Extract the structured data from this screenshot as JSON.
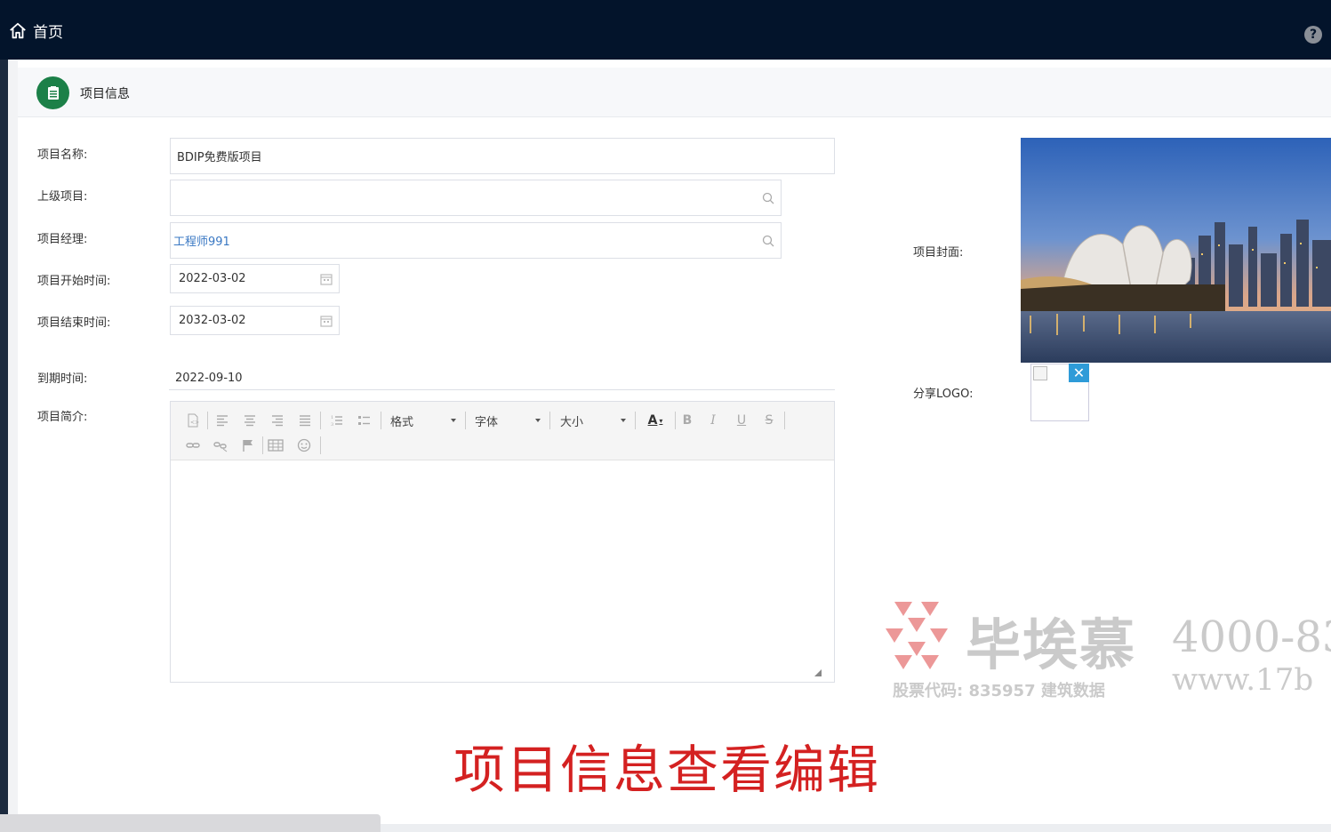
{
  "topbar": {
    "home_label": "首页",
    "help_glyph": "?"
  },
  "panel": {
    "title": "项目信息"
  },
  "form": {
    "name_label": "项目名称:",
    "name_value": "BDIP免费版项目",
    "parent_label": "上级项目:",
    "parent_value": "",
    "manager_label": "项目经理:",
    "manager_value": "工程师991",
    "start_label": "项目开始时间:",
    "start_value": "2022-03-02",
    "end_label": "项目结束时间:",
    "end_value": "2032-03-02",
    "expire_label": "到期时间:",
    "expire_value": "2022-09-10",
    "intro_label": "项目简介:",
    "cover_label": "项目封面:",
    "logo_label": "分享LOGO:"
  },
  "editor": {
    "format_label": "格式",
    "font_label": "字体",
    "size_label": "大小",
    "bold": "B",
    "italic": "I",
    "underline": "U",
    "strike": "S",
    "color_letter": "A"
  },
  "watermark": {
    "brand": "毕埃慕",
    "phone": "4000-83",
    "stock_code": "股票代码: 835957 建筑数据",
    "url": "www.17b"
  },
  "caption": "项目信息查看编辑",
  "colors": {
    "topbar": "#03142b",
    "accent_green": "#1c8048",
    "link": "#3a78c3",
    "caption_red": "#d42121",
    "close_blue": "#2e9bd8"
  },
  "icons": [
    "home-icon",
    "help-icon",
    "document-icon",
    "search-icon",
    "calendar-icon",
    "close-icon"
  ]
}
